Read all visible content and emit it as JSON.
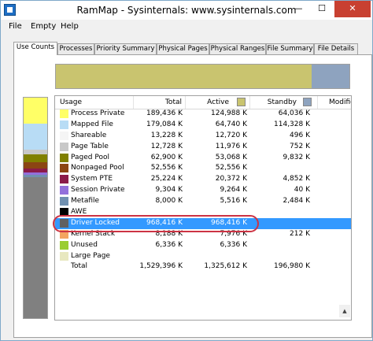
{
  "window": {
    "title": "RamMap - Sysinternals: www.sysinternals.com"
  },
  "title_buttons": {
    "minimize": "—",
    "maximize": "☐",
    "close": "✕"
  },
  "menu": [
    "File",
    "Empty",
    "Help"
  ],
  "tabs": [
    "Use Counts",
    "Processes",
    "Priority Summary",
    "Physical Pages",
    "Physical Ranges",
    "File Summary",
    "File Details"
  ],
  "colors": {
    "active": "#c9c46f",
    "standby": "#8ea3bf",
    "highlight_ring": "#cc3344",
    "selection": "#3399ff"
  },
  "table": {
    "columns": {
      "usage": "Usage",
      "total": "Total",
      "active": "Active",
      "standby": "Standby",
      "modified": "Modifie"
    },
    "rows": [
      {
        "usage": "Process Private",
        "total": "189,436 K",
        "active": "124,988 K",
        "standby": "64,036 K",
        "color": "#ffff66"
      },
      {
        "usage": "Mapped File",
        "total": "179,084 K",
        "active": "64,740 K",
        "standby": "114,328 K",
        "color": "#b8dcf5"
      },
      {
        "usage": "Shareable",
        "total": "13,228 K",
        "active": "12,720 K",
        "standby": "496 K",
        "color": "#f5f5f5"
      },
      {
        "usage": "Page Table",
        "total": "12,728 K",
        "active": "11,976 K",
        "standby": "752 K",
        "color": "#c8c8c8"
      },
      {
        "usage": "Paged Pool",
        "total": "62,900 K",
        "active": "53,068 K",
        "standby": "9,832 K",
        "color": "#808000"
      },
      {
        "usage": "Nonpaged Pool",
        "total": "52,556 K",
        "active": "52,556 K",
        "standby": "",
        "color": "#8b4513"
      },
      {
        "usage": "System PTE",
        "total": "25,224 K",
        "active": "20,372 K",
        "standby": "4,852 K",
        "color": "#8b1a4a"
      },
      {
        "usage": "Session Private",
        "total": "9,304 K",
        "active": "9,264 K",
        "standby": "40 K",
        "color": "#9370db"
      },
      {
        "usage": "Metafile",
        "total": "8,000 K",
        "active": "5,516 K",
        "standby": "2,484 K",
        "color": "#7090b0"
      },
      {
        "usage": "AWE",
        "total": "",
        "active": "",
        "standby": "",
        "color": "#000000"
      },
      {
        "usage": "Driver Locked",
        "total": "968,416 K",
        "active": "968,416 K",
        "standby": "",
        "color": "#606060",
        "selected": true
      },
      {
        "usage": "Kernel Stack",
        "total": "8,188 K",
        "active": "7,976 K",
        "standby": "212 K",
        "color": "#f4a460"
      },
      {
        "usage": "Unused",
        "total": "6,336 K",
        "active": "6,336 K",
        "standby": "",
        "color": "#9acd32"
      },
      {
        "usage": "Large Page",
        "total": "",
        "active": "",
        "standby": "",
        "color": "#e8e8c0"
      },
      {
        "usage": "Total",
        "total": "1,529,396 K",
        "active": "1,325,612 K",
        "standby": "196,980 K",
        "color": ""
      }
    ]
  }
}
